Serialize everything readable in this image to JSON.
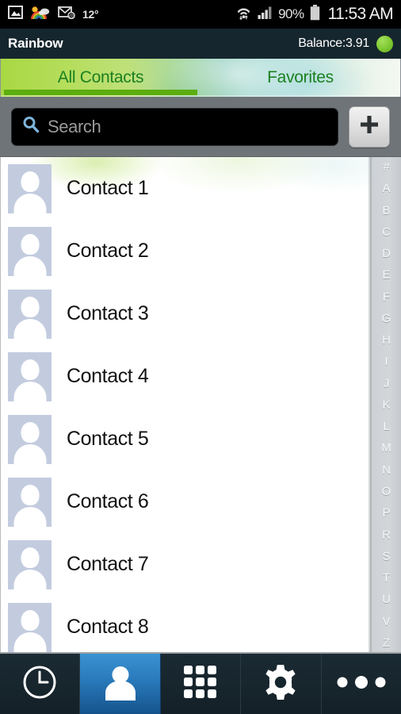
{
  "statusbar": {
    "temperature": "12°",
    "battery_percent": "90%",
    "time": "11:53 AM",
    "icons": [
      "gallery-icon",
      "weather-rainbow-icon",
      "email-icon",
      "wifi-icon",
      "signal-bars-icon",
      "battery-icon"
    ]
  },
  "titlebar": {
    "app_name": "Rainbow",
    "balance_label": "Balance:3.91",
    "status_dot_color": "#7ec832"
  },
  "tabs": [
    {
      "label": "All Contacts",
      "active": true
    },
    {
      "label": "Favorites",
      "active": false
    }
  ],
  "search": {
    "placeholder": "Search",
    "value": "",
    "icon": "search-icon",
    "add_button_icon": "plus-icon"
  },
  "contacts": [
    {
      "name": "Contact 1",
      "avatar": "person-placeholder-icon"
    },
    {
      "name": "Contact 2",
      "avatar": "person-placeholder-icon"
    },
    {
      "name": "Contact 3",
      "avatar": "person-placeholder-icon"
    },
    {
      "name": "Contact 4",
      "avatar": "person-placeholder-icon"
    },
    {
      "name": "Contact 5",
      "avatar": "person-placeholder-icon"
    },
    {
      "name": "Contact 6",
      "avatar": "person-placeholder-icon"
    },
    {
      "name": "Contact 7",
      "avatar": "person-placeholder-icon"
    },
    {
      "name": "Contact 8",
      "avatar": "person-placeholder-icon"
    }
  ],
  "alpha_index": [
    "#",
    "A",
    "B",
    "C",
    "D",
    "E",
    "F",
    "G",
    "H",
    "I",
    "J",
    "K",
    "L",
    "M",
    "N",
    "O",
    "P",
    "R",
    "S",
    "T",
    "U",
    "V",
    "Z"
  ],
  "bottomnav": [
    {
      "name": "history",
      "icon": "clock-icon",
      "active": false
    },
    {
      "name": "contacts",
      "icon": "person-icon",
      "active": true
    },
    {
      "name": "keypad",
      "icon": "dialpad-grid-icon",
      "active": false
    },
    {
      "name": "settings",
      "icon": "gear-icon",
      "active": false
    },
    {
      "name": "more",
      "icon": "more-dots-icon",
      "active": false
    }
  ],
  "colors": {
    "titlebar_bg": "#16262e",
    "tab_active_underline": "#5cad0f",
    "tab_text": "#1b8020",
    "nav_active_blue": "#2a7cbd",
    "searchbar_bg": "#6e7478"
  }
}
